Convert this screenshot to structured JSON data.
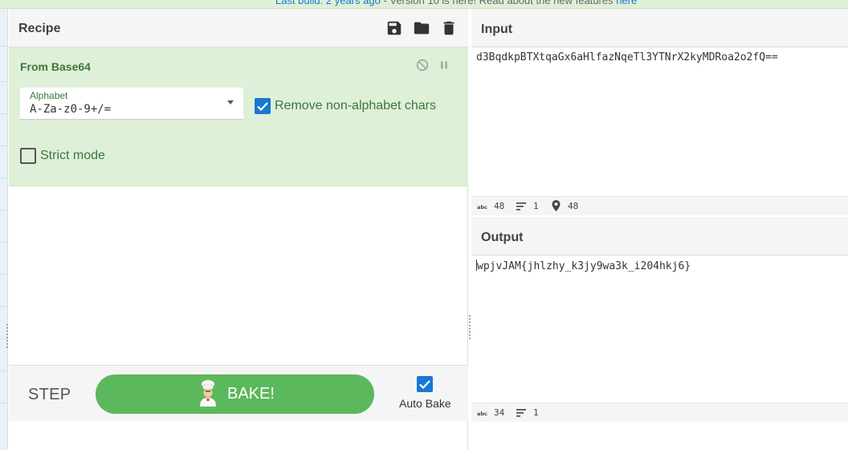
{
  "notice": {
    "link1": "Last build: 2 years ago",
    "text": " - Version 10 is here! Read about the new features ",
    "link2": "here"
  },
  "recipe": {
    "title": "Recipe",
    "icons": [
      "save-icon",
      "folder-icon",
      "trash-icon"
    ],
    "operation": {
      "title": "From Base64",
      "alphabet_label": "Alphabet",
      "alphabet_value": "A-Za-z0-9+/=",
      "remove_nonalpha_label": "Remove non-alphabet chars",
      "remove_nonalpha_checked": true,
      "strict_mode_label": "Strict mode",
      "strict_mode_checked": false
    },
    "controls": {
      "step_label": "STEP",
      "bake_label": "BAKE!",
      "auto_bake_label": "Auto Bake",
      "auto_bake_checked": true
    }
  },
  "input": {
    "title": "Input",
    "text": "d3BqdkpBTXtqaGx6aHlfazNqeTl3YTNrX2kyMDRoa2o2fQ==",
    "length": "48",
    "lines": "1",
    "position": "48"
  },
  "output": {
    "title": "Output",
    "text": "wpjvJAM{jhlzhy_k3jy9wa3k_i204hkj6}",
    "length": "34",
    "lines": "1"
  },
  "colors": {
    "operation_bg": "#dff0d8",
    "bake_green": "#5cb85c",
    "checkbox_blue": "#1976d2",
    "op_text_green": "#3c763d"
  }
}
